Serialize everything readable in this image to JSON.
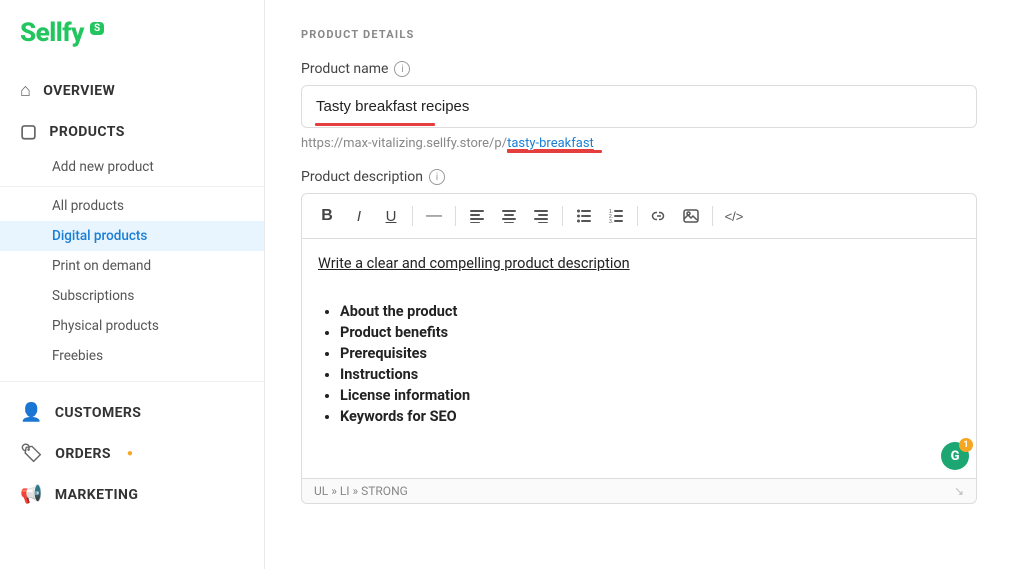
{
  "logo": {
    "text": "Sellfy",
    "badge": "S"
  },
  "sidebar": {
    "nav_items": [
      {
        "id": "overview",
        "label": "OVERVIEW",
        "icon": "⌂"
      },
      {
        "id": "products",
        "label": "PRODUCTS",
        "icon": "▢"
      }
    ],
    "sub_items": [
      {
        "id": "add-new-product",
        "label": "Add new product",
        "active": false
      },
      {
        "id": "all-products",
        "label": "All products",
        "active": false
      },
      {
        "id": "digital-products",
        "label": "Digital products",
        "active": true
      },
      {
        "id": "print-on-demand",
        "label": "Print on demand",
        "active": false
      },
      {
        "id": "subscriptions",
        "label": "Subscriptions",
        "active": false
      },
      {
        "id": "physical-products",
        "label": "Physical products",
        "active": false
      },
      {
        "id": "freebies",
        "label": "Freebies",
        "active": false
      }
    ],
    "bottom_nav": [
      {
        "id": "customers",
        "label": "CUSTOMERS",
        "icon": "👤"
      },
      {
        "id": "orders",
        "label": "ORDERS",
        "icon": "🏷",
        "badge": "●"
      },
      {
        "id": "marketing",
        "label": "MARKETING",
        "icon": "📢"
      }
    ]
  },
  "main": {
    "section_title": "PRODUCT DETAILS",
    "product_name_label": "Product name",
    "product_name_value": "Tasty breakfast recipes",
    "url_prefix": "https://max-vitalizing.sellfy.store/p/",
    "url_slug": "tasty-breakfast",
    "product_description_label": "Product description",
    "editor_placeholder": "Write a clear and compelling product description",
    "editor_list_items": [
      "About the product",
      "Product benefits",
      "Prerequisites",
      "Instructions",
      "License information",
      "Keywords for SEO"
    ],
    "statusbar_text": "UL » LI » STRONG",
    "toolbar": {
      "bold": "B",
      "italic": "I",
      "underline": "U"
    },
    "grammarly_count": "1"
  }
}
